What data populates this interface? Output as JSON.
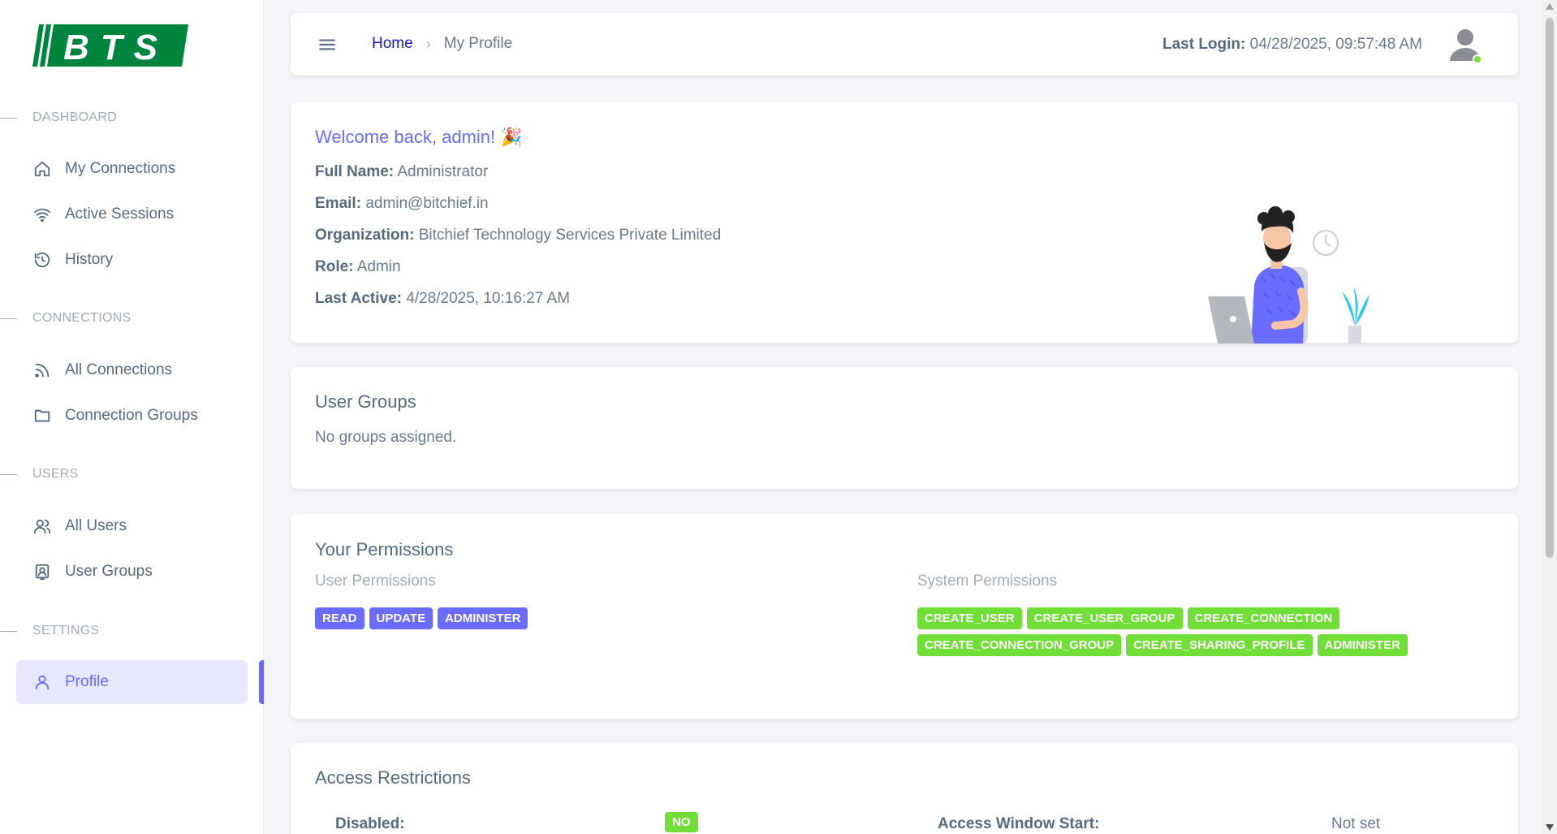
{
  "brand": {
    "logo_text": "BTS",
    "color": "#00853f"
  },
  "sidebar": {
    "sections": [
      {
        "header": "DASHBOARD",
        "items": [
          {
            "label": "My Connections",
            "icon": "home-icon"
          },
          {
            "label": "Active Sessions",
            "icon": "wifi-icon"
          },
          {
            "label": "History",
            "icon": "history-icon"
          }
        ]
      },
      {
        "header": "CONNECTIONS",
        "items": [
          {
            "label": "All Connections",
            "icon": "rss-icon"
          },
          {
            "label": "Connection Groups",
            "icon": "folder-icon"
          }
        ]
      },
      {
        "header": "USERS",
        "items": [
          {
            "label": "All Users",
            "icon": "users-icon"
          },
          {
            "label": "User Groups",
            "icon": "user-group-icon"
          }
        ]
      },
      {
        "header": "SETTINGS",
        "items": [
          {
            "label": "Profile",
            "icon": "user-icon",
            "active": true
          }
        ]
      }
    ]
  },
  "navbar": {
    "breadcrumb": {
      "home": "Home",
      "separator": "›",
      "current": "My Profile"
    },
    "last_login_label": "Last Login:",
    "last_login_value": "04/28/2025, 09:57:48 AM",
    "status_color": "#71dd37"
  },
  "welcome": {
    "title": "Welcome back, admin! 🎉",
    "fields": [
      {
        "label": "Full Name:",
        "value": "Administrator"
      },
      {
        "label": "Email:",
        "value": "admin@bitchief.in"
      },
      {
        "label": "Organization:",
        "value": "Bitchief Technology Services Private Limited"
      },
      {
        "label": "Role:",
        "value": "Admin"
      },
      {
        "label": "Last Active:",
        "value": "4/28/2025, 10:16:27 AM"
      }
    ]
  },
  "user_groups": {
    "title": "User Groups",
    "empty_text": "No groups assigned."
  },
  "permissions": {
    "title": "Your Permissions",
    "user_title": "User Permissions",
    "user": [
      "READ",
      "UPDATE",
      "ADMINISTER"
    ],
    "system_title": "System Permissions",
    "system": [
      "CREATE_USER",
      "CREATE_USER_GROUP",
      "CREATE_CONNECTION",
      "CREATE_CONNECTION_GROUP",
      "CREATE_SHARING_PROFILE",
      "ADMINISTER"
    ]
  },
  "access": {
    "title": "Access Restrictions",
    "disabled_label": "Disabled:",
    "disabled_value": "NO",
    "window_start_label": "Access Window Start:",
    "window_start_value": "Not set"
  }
}
